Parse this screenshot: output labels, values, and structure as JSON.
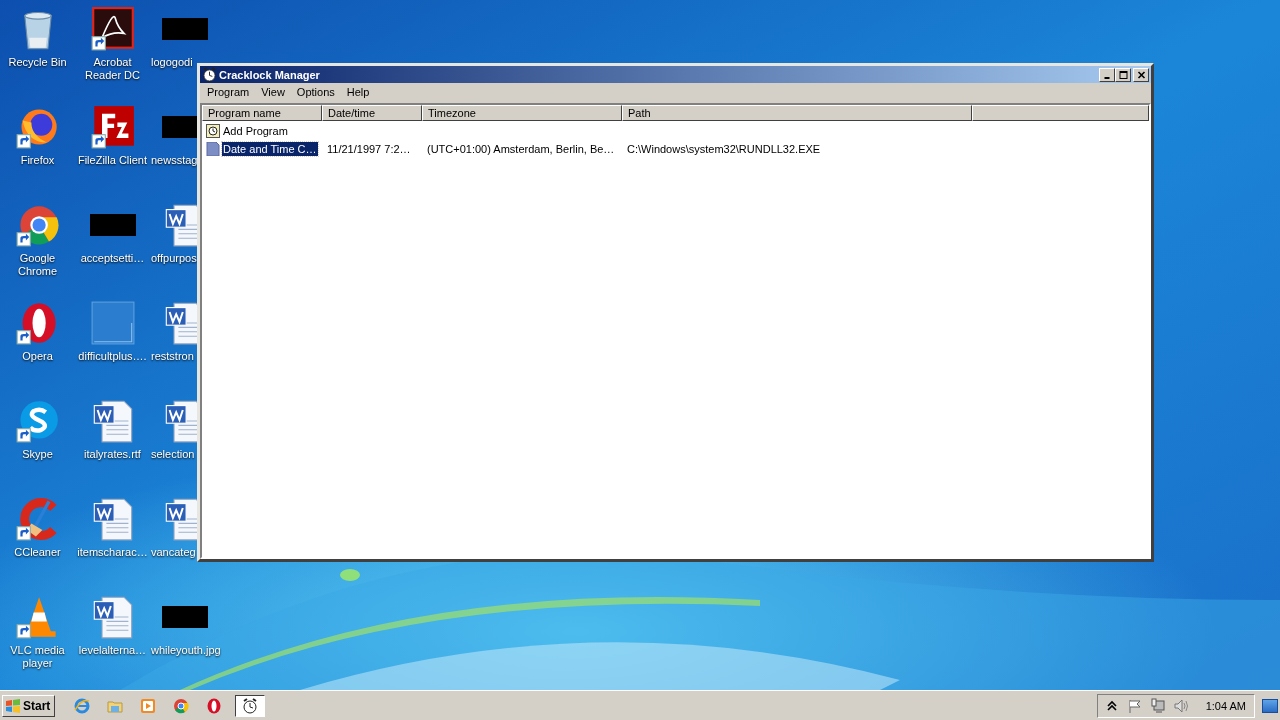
{
  "desktop": {
    "columns": [
      [
        {
          "label": "Recycle Bin",
          "kind": "recycle",
          "shortcut": false
        },
        {
          "label": "Firefox",
          "kind": "firefox",
          "shortcut": true
        },
        {
          "label": "Google Chrome",
          "kind": "chrome",
          "shortcut": true
        },
        {
          "label": "Opera",
          "kind": "opera",
          "shortcut": true
        },
        {
          "label": "Skype",
          "kind": "skype",
          "shortcut": true
        },
        {
          "label": "CCleaner",
          "kind": "ccleaner",
          "shortcut": true
        },
        {
          "label": "VLC media player",
          "kind": "vlc",
          "shortcut": true
        }
      ],
      [
        {
          "label": "Acrobat Reader DC",
          "kind": "acrobat",
          "shortcut": true
        },
        {
          "label": "FileZilla Client",
          "kind": "filezilla",
          "shortcut": true
        },
        {
          "label": "acceptsetti…",
          "kind": "redacted",
          "shortcut": false
        },
        {
          "label": "difficultplus….",
          "kind": "blank",
          "shortcut": false
        },
        {
          "label": "italyrates.rtf",
          "kind": "word",
          "shortcut": false
        },
        {
          "label": "itemscharac…",
          "kind": "word",
          "shortcut": false
        },
        {
          "label": "levelalterna…",
          "kind": "word",
          "shortcut": false
        }
      ],
      [
        {
          "label": "logogodi",
          "kind": "redacted",
          "shortcut": false
        },
        {
          "label": "newsstag",
          "kind": "redacted",
          "shortcut": false
        },
        {
          "label": "offpurpos",
          "kind": "word",
          "shortcut": false
        },
        {
          "label": "reststron",
          "kind": "word",
          "shortcut": false
        },
        {
          "label": "selection",
          "kind": "word",
          "shortcut": false
        },
        {
          "label": "vancateg",
          "kind": "word",
          "shortcut": false
        },
        {
          "label": "whileyouth.jpg",
          "kind": "redacted",
          "shortcut": false
        }
      ]
    ]
  },
  "window": {
    "title": "Cracklock Manager",
    "menu": [
      "Program",
      "View",
      "Options",
      "Help"
    ],
    "columns": [
      "Program name",
      "Date/time",
      "Timezone",
      "Path"
    ],
    "rows": [
      {
        "kind": "add",
        "selected": false,
        "cells": [
          "Add Program"
        ]
      },
      {
        "kind": "program",
        "selected": true,
        "cells": [
          "Date and Time C…",
          "11/21/1997 7:2…",
          "(UTC+01:00) Amsterdam, Berlin, Be…",
          "C:\\Windows\\system32\\RUNDLL32.EXE"
        ]
      }
    ]
  },
  "taskbar": {
    "start": "Start",
    "buttons": [
      {
        "kind": "ie",
        "active": false
      },
      {
        "kind": "folder",
        "active": false
      },
      {
        "kind": "media",
        "active": false
      },
      {
        "kind": "chrome",
        "active": false
      },
      {
        "kind": "opera",
        "active": false
      },
      {
        "kind": "clock",
        "active": true
      }
    ],
    "tray": [
      {
        "kind": "chevron"
      },
      {
        "kind": "flag"
      },
      {
        "kind": "network"
      },
      {
        "kind": "speaker"
      }
    ],
    "clock": "1:04 AM"
  }
}
